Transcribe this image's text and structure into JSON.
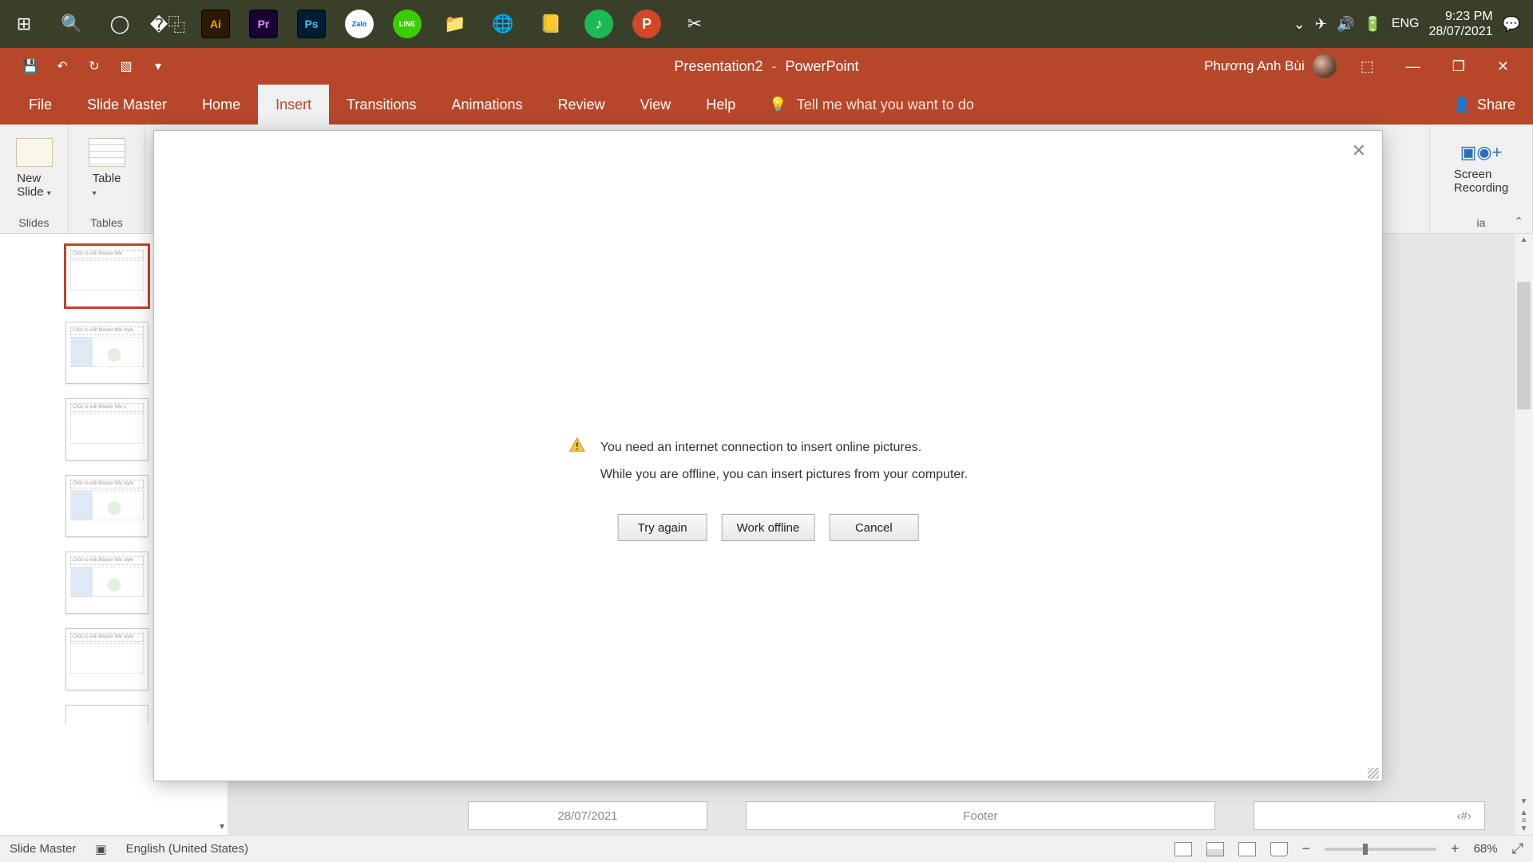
{
  "taskbar": {
    "apps": [
      {
        "name": "start-icon",
        "glyph": "⊞",
        "style": "plain"
      },
      {
        "name": "search-icon",
        "glyph": "🔍",
        "style": "plain"
      },
      {
        "name": "cortana-icon",
        "glyph": "◯",
        "style": "plain"
      },
      {
        "name": "taskview-icon",
        "glyph": "�⿻",
        "style": "plain"
      },
      {
        "name": "illustrator-icon",
        "glyph": "Ai",
        "bg": "#2b1a00",
        "fg": "#ff9a00"
      },
      {
        "name": "premiere-icon",
        "glyph": "Pr",
        "bg": "#1a0033",
        "fg": "#d490ff"
      },
      {
        "name": "photoshop-icon",
        "glyph": "Ps",
        "bg": "#001d33",
        "fg": "#38c3ff"
      },
      {
        "name": "zalo-icon",
        "glyph": "Zalo",
        "circle": true,
        "fg": "#0068ff"
      },
      {
        "name": "line-icon",
        "glyph": "LINE",
        "circle": true,
        "bg": "#3ace01",
        "fg": "#fff"
      },
      {
        "name": "explorer-icon",
        "glyph": "📁",
        "style": "plain"
      },
      {
        "name": "edge-icon",
        "glyph": "🌐",
        "style": "plain"
      },
      {
        "name": "notes-icon",
        "glyph": "📒",
        "style": "plain"
      },
      {
        "name": "spotify-icon",
        "glyph": "♪",
        "circle": true,
        "bg": "#1db954",
        "fg": "#fff"
      },
      {
        "name": "powerpoint-icon",
        "glyph": "P",
        "circle": true,
        "bg": "#d24726",
        "fg": "#fff"
      },
      {
        "name": "snip-icon",
        "glyph": "✂",
        "style": "plain"
      }
    ],
    "sys": {
      "lang": "ENG",
      "time": "9:23 PM",
      "date": "28/07/2021"
    }
  },
  "titlebar": {
    "doc": "Presentation2",
    "app": "PowerPoint",
    "user": "Phương Anh Bùi"
  },
  "tabs": [
    "File",
    "Slide Master",
    "Home",
    "Insert",
    "Transitions",
    "Animations",
    "Review",
    "View",
    "Help"
  ],
  "active_tab": "Insert",
  "tell": "Tell me what you want to do",
  "share": "Share",
  "ribbon": {
    "groups": [
      {
        "name": "Slides",
        "btn_line1": "New",
        "btn_line2": "Slide"
      },
      {
        "name": "Tables",
        "btn": "Table"
      },
      {
        "name": "ia",
        "btn_line1": "Screen",
        "btn_line2": "Recording"
      }
    ]
  },
  "thumbs": [
    {
      "hdr": "Click to edit Master title"
    },
    {
      "hdr": "Click to edit Master title style",
      "diag": true
    },
    {
      "hdr": "Click to edit Master title s"
    },
    {
      "hdr": "Click to edit Master title style",
      "diag": true
    },
    {
      "hdr": "Click to edit Master title style",
      "diag": true
    },
    {
      "hdr": "Click to edit Master title style"
    }
  ],
  "footer": {
    "date": "28/07/2021",
    "label": "Footer",
    "pagenum": "‹#›"
  },
  "statusbar": {
    "mode": "Slide Master",
    "lang": "English (United States)",
    "zoom": "68%"
  },
  "dialog": {
    "line1": "You need an internet connection to insert online pictures.",
    "line2": "While you are offline, you can insert pictures from your computer.",
    "btn_try": "Try again",
    "btn_offline": "Work offline",
    "btn_cancel": "Cancel"
  }
}
